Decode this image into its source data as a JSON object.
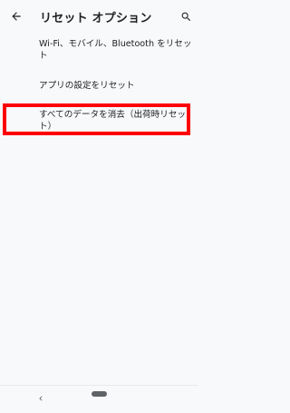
{
  "appbar": {
    "title": "リセット オプション",
    "back_icon": "arrow-back-icon",
    "search_icon": "search-icon"
  },
  "options": [
    {
      "label": "Wi-Fi、モバイル、Bluetooth をリセット"
    },
    {
      "label": "アプリの設定をリセット"
    },
    {
      "label": "すべてのデータを消去（出荷時リセット）"
    }
  ],
  "navbar": {
    "back_icon": "chevron-left-icon",
    "home_icon": "home-pill-icon"
  },
  "colors": {
    "highlight": "#ff0000",
    "background": "#f8f9fa",
    "text": "#202124"
  }
}
